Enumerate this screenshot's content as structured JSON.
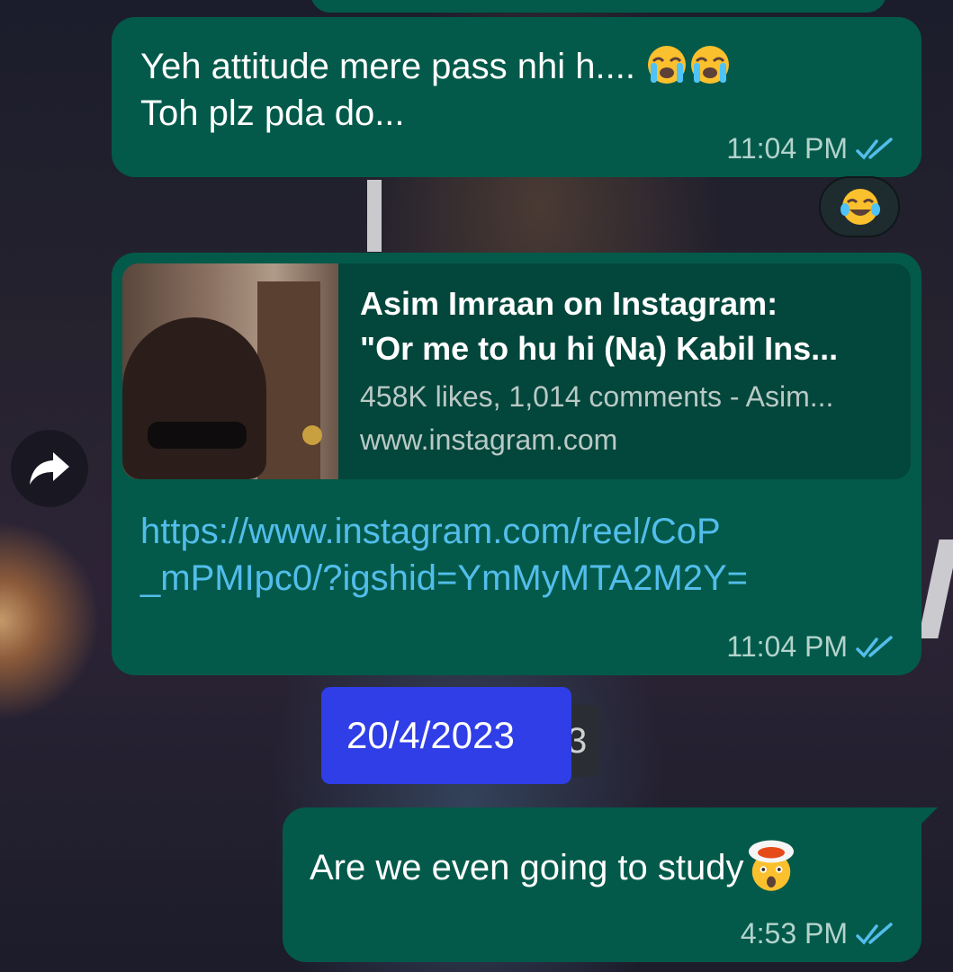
{
  "messages": [
    {
      "line1": "Yeh attitude mere pass nhi h....",
      "line2": "Toh plz pda do...",
      "time": "11:04 PM"
    },
    {
      "preview_title_1": "Asim Imraan on Instagram:",
      "preview_title_2": "\"Or me to hu hi (Na) Kabil Ins...",
      "preview_desc": "458K likes, 1,014 comments - Asim...",
      "preview_domain": "www.instagram.com",
      "url_line1": "https://www.instagram.com/reel/CoP",
      "url_line2": "_mPMIpc0/?igshid=YmMyMTA2M2Y=",
      "time": "11:04 PM"
    },
    {
      "text": "Are we even going to study",
      "time": "4:53 PM"
    }
  ],
  "date_chip": "20/4/2023",
  "date_chip_hidden_suffix": "3",
  "reaction": "face-with-tears-of-joy",
  "icons": [
    "double-check-icon",
    "forward-arrow-icon",
    "loudly-crying-face-emoji",
    "exploding-head-emoji"
  ],
  "colors": {
    "bubble": "#035a4a",
    "preview": "#03463b",
    "link": "#53bdeb",
    "tick": "#53bdeb",
    "date_chip": "#2f3ee6"
  }
}
